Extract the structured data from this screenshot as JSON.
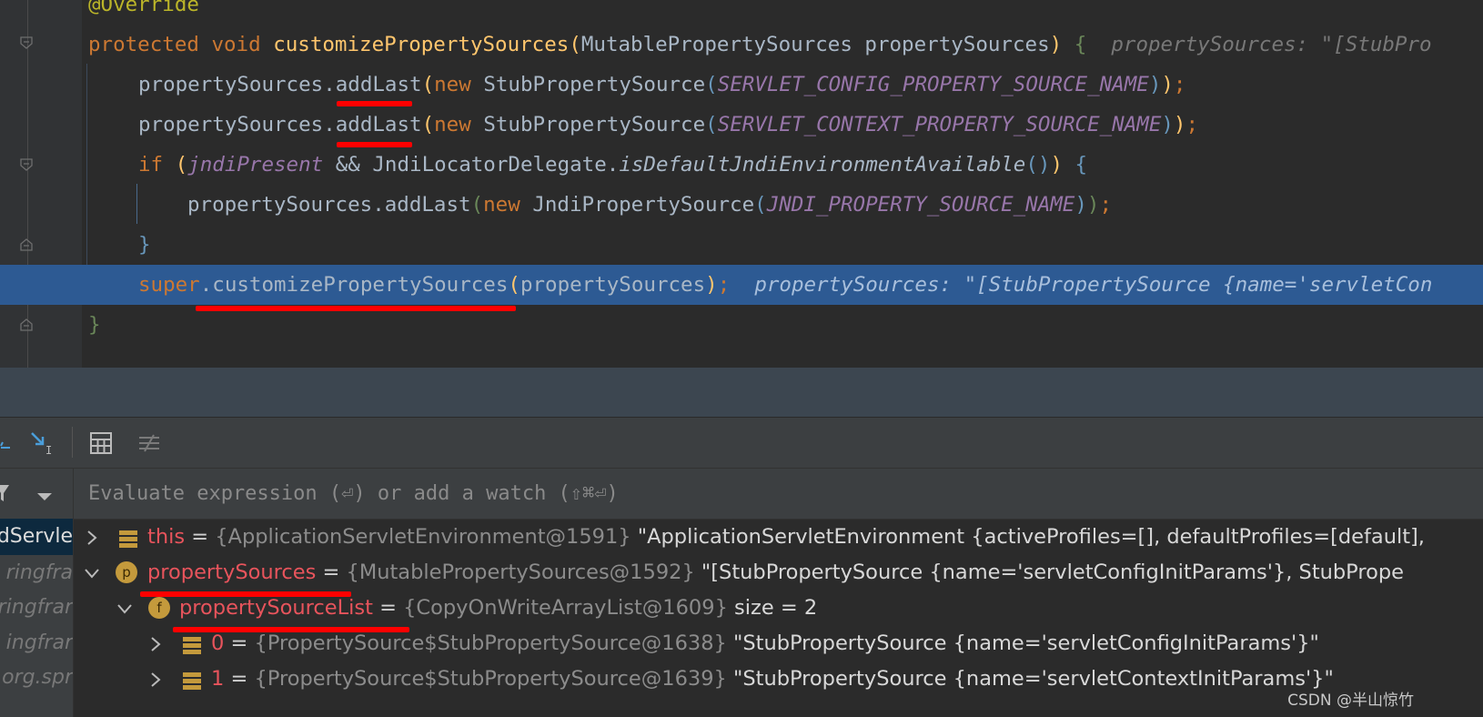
{
  "editor": {
    "lines": [
      {
        "annotation": "@Override"
      },
      {
        "kw_protected": "protected",
        "kw_void": "void",
        "method": "customizePropertySources",
        "open": "(",
        "ptype": "MutablePropertySources",
        "pname": "propertySources",
        "close": ")",
        "brace": "{",
        "hint": "propertySources: \"[StubPro"
      },
      {
        "obj": "propertySources",
        "dot": ".",
        "call": "addLast",
        "open": "(",
        "kw_new": "new",
        "cls": "StubPropertySource",
        "open2": "(",
        "const": "SERVLET_CONFIG_PROPERTY_SOURCE_NAME",
        "close": "));",
        "semi": ";"
      },
      {
        "obj": "propertySources",
        "dot": ".",
        "call": "addLast",
        "open": "(",
        "kw_new": "new",
        "cls": "StubPropertySource",
        "open2": "(",
        "const": "SERVLET_CONTEXT_PROPERTY_SOURCE_NAME",
        "close": "));",
        "semi": ";"
      },
      {
        "kw_if": "if",
        "open": "(",
        "var": "jndiPresent",
        "and": "&&",
        "cls": "JndiLocatorDelegate",
        "dot": ".",
        "smethod": "isDefaultJndiEnvironmentAvailable",
        "parens": "()",
        "close": ")",
        "brace": "{"
      },
      {
        "obj": "propertySources",
        "dot": ".",
        "call": "addLast",
        "open": "(",
        "kw_new": "new",
        "cls": "JndiPropertySource",
        "open2": "(",
        "const": "JNDI_PROPERTY_SOURCE_NAME",
        "close": "));",
        "semi": ";"
      },
      {
        "brace": "}"
      },
      {
        "kw_super": "super",
        "dot": ".",
        "call": "customizePropertySources",
        "open": "(",
        "arg": "propertySources",
        "close": ");",
        "hint": "propertySources: \"[StubPropertySource {name='servletCon"
      },
      {
        "brace": "}"
      }
    ]
  },
  "debug": {
    "eval_placeholder": "Evaluate expression (⏎) or add a watch (⇧⌘⏎)",
    "frames": [
      "dServle",
      "ringfra",
      "ringfrar",
      "ingfrar",
      "org.spr"
    ],
    "vars": [
      {
        "name": "this",
        "eq": "=",
        "type": "{ApplicationServletEnvironment@1591}",
        "value": "\"ApplicationServletEnvironment {activeProfiles=[], defaultProfiles=[default],"
      },
      {
        "badge": "p",
        "name": "propertySources",
        "eq": "=",
        "type": "{MutablePropertySources@1592}",
        "value": "\"[StubPropertySource {name='servletConfigInitParams'}, StubPrope"
      },
      {
        "badge": "f",
        "name": "propertySourceList",
        "eq": "=",
        "type": "{CopyOnWriteArrayList@1609}",
        "value": " size = 2"
      },
      {
        "name": "0",
        "eq": "=",
        "type": "{PropertySource$StubPropertySource@1638}",
        "value": "\"StubPropertySource {name='servletConfigInitParams'}\""
      },
      {
        "name": "1",
        "eq": "=",
        "type": "{PropertySource$StubPropertySource@1639}",
        "value": "\"StubPropertySource {name='servletContextInitParams'}\""
      }
    ]
  },
  "watermark": "CSDN @半山惊竹",
  "colors": {
    "keyword": "#cc7832",
    "method": "#ffc66d",
    "constant": "#9876aa",
    "highlight": "#2d5a93",
    "underline": "#ff0000",
    "var_name": "#e8545c"
  }
}
